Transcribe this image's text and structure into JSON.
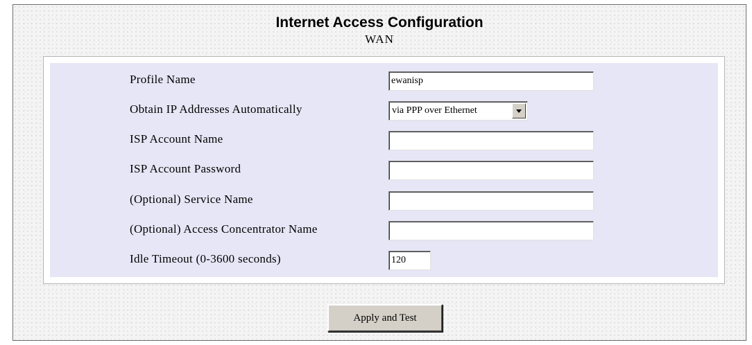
{
  "header": {
    "title": "Internet Access Configuration",
    "subtitle": "WAN"
  },
  "form": {
    "profile_name": {
      "label": "Profile Name",
      "value": "ewanisp"
    },
    "obtain_ip": {
      "label": "Obtain IP Addresses Automatically",
      "selected": "via PPP over Ethernet"
    },
    "isp_account_name": {
      "label": "ISP Account Name",
      "value": ""
    },
    "isp_account_password": {
      "label": "ISP Account Password",
      "value": ""
    },
    "service_name": {
      "label": "(Optional) Service Name",
      "value": ""
    },
    "access_concentrator": {
      "label": "(Optional) Access Concentrator Name",
      "value": ""
    },
    "idle_timeout": {
      "label": "Idle Timeout (0-3600 seconds)",
      "value": "120"
    }
  },
  "actions": {
    "apply_label": "Apply and Test"
  },
  "colors": {
    "panel_background": "#e6e6f6",
    "button_face": "#d4d0c8"
  },
  "icons": {
    "dropdown": "chevron-down-icon"
  }
}
